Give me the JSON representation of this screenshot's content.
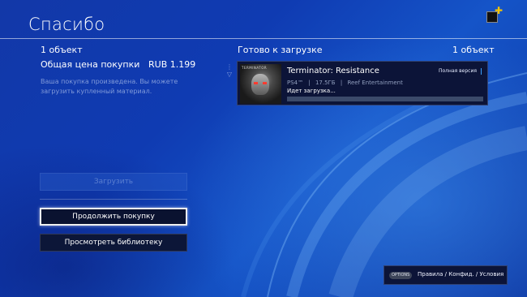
{
  "header": {
    "title": "Спасибо"
  },
  "icons": {
    "profile": "profile-avatar",
    "plus": "ps-plus-icon"
  },
  "summary": {
    "count": "1 объект",
    "price_label": "Общая цена покупки",
    "price_value": "RUB 1.199",
    "note": "Ваша покупка произведена. Вы можете загрузить купленный материал."
  },
  "buttons": {
    "download": "Загрузить",
    "continue": "Продолжить покупку",
    "library": "Просмотреть библиотеку"
  },
  "downloads": {
    "header": "Готово к загрузке",
    "count": "1 объект",
    "item": {
      "title": "Terminator: Resistance",
      "badge": "Полная версия",
      "platform": "PS4™",
      "size": "17.5ГБ",
      "publisher": "Reef Entertainment",
      "status": "Идет загрузка...",
      "cover_text": "TERMINATOR",
      "progress": 0
    }
  },
  "footer": {
    "options_button": "OPTIONS",
    "options_label": "Правила / Конфид. / Условия"
  },
  "colors": {
    "background": "#0f3bb2",
    "accent": "#3aa0ff",
    "plus": "#f5c400"
  }
}
